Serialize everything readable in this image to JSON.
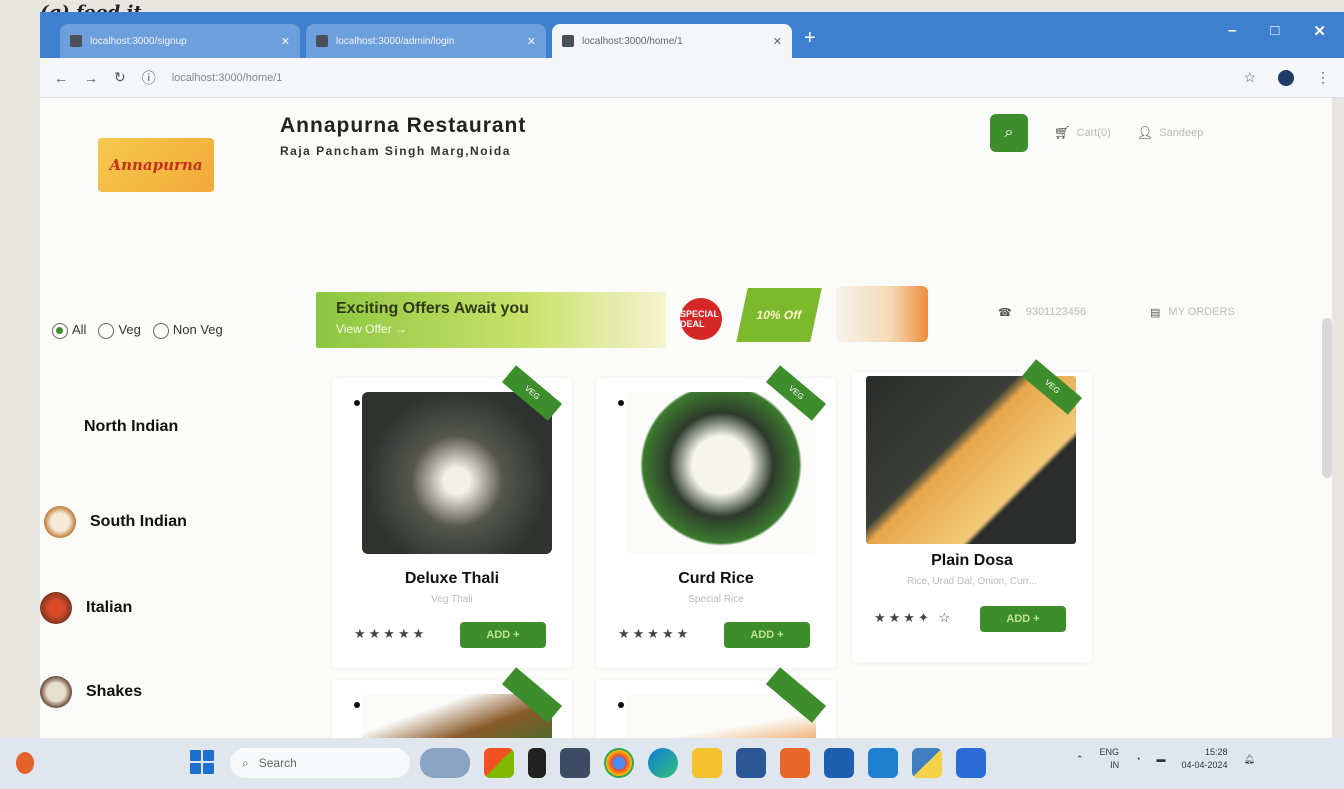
{
  "caption": "(g) food it",
  "browser": {
    "tabs": [
      {
        "title": "localhost:3000/signup"
      },
      {
        "title": "localhost:3000/admin/login"
      },
      {
        "title": "localhost:3000/home/1",
        "active": true
      }
    ],
    "new_tab": "+",
    "url": "localhost:3000/home/1",
    "window_controls": [
      "–",
      "□",
      "✕"
    ]
  },
  "header": {
    "logo_text": "Annapurna",
    "restaurant_name": "Annapurna Restaurant",
    "address": "Raja Pancham Singh Marg,Noida",
    "cart_label": "Cart(0)",
    "login_label": "Sandeep"
  },
  "offer": {
    "title": "Exciting Offers Await you",
    "link": "View Offer →",
    "badge": "SPECIAL DEAL",
    "percent": "10% Off"
  },
  "contact": {
    "phone": "9301123456",
    "orders_label": "MY ORDERS"
  },
  "filters": {
    "options": [
      {
        "label": "All",
        "selected": true
      },
      {
        "label": "Veg",
        "selected": false
      },
      {
        "label": "Non Veg",
        "selected": false
      }
    ]
  },
  "categories": [
    {
      "label": "North Indian"
    },
    {
      "label": "South Indian"
    },
    {
      "label": "Italian"
    },
    {
      "label": "Shakes"
    }
  ],
  "products": [
    {
      "name": "Deluxe Thali",
      "desc": "Veg Thali",
      "rating": 5,
      "stars": "★★★★★",
      "add_label": "ADD +",
      "ribbon": "VEG"
    },
    {
      "name": "Curd Rice",
      "desc": "Special Rice",
      "rating": 5,
      "stars": "★★★★★",
      "add_label": "ADD +",
      "ribbon": "VEG"
    },
    {
      "name": "Plain Dosa",
      "desc": "Rice, Urad Dal, Onion, Curr...",
      "rating": 3.5,
      "stars": "★★★✦ ☆",
      "add_label": "ADD +",
      "ribbon": "VEG"
    }
  ],
  "taskbar": {
    "search_placeholder": "Search",
    "lang_line1": "ENG",
    "lang_line2": "IN",
    "time": "15:28",
    "date": "04-04-2024"
  },
  "colors": {
    "brand_green": "#3e8d2c",
    "tab_blue": "#3f7fd0"
  }
}
